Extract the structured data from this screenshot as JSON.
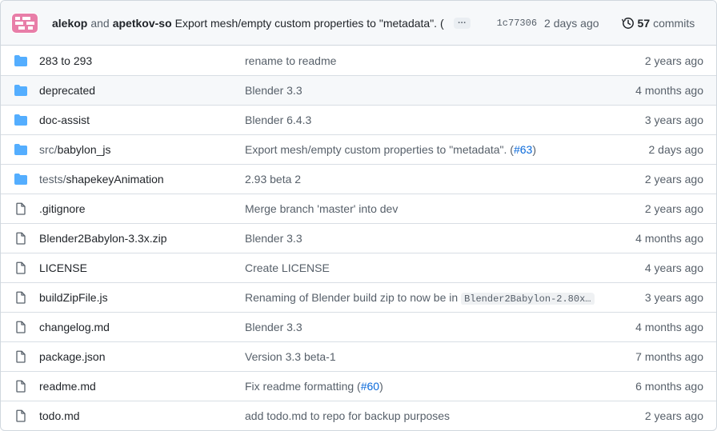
{
  "latest_commit": {
    "author1": "alekop",
    "and": "and",
    "author2": "apetkov-so",
    "message": "Export mesh/empty custom properties to \"metadata\". (",
    "ellipsis": "…",
    "sha": "1c77306",
    "date": "2 days ago",
    "commit_count": "57",
    "commits_label": "commits",
    "icon": "history-icon"
  },
  "files": [
    {
      "type": "folder",
      "name": "283 to 293",
      "message": "rename to readme",
      "age": "2 years ago"
    },
    {
      "type": "folder",
      "name": "deprecated",
      "message": "Blender 3.3",
      "age": "4 months ago"
    },
    {
      "type": "folder",
      "name": "doc-assist",
      "message": "Blender 6.4.3",
      "age": "3 years ago"
    },
    {
      "type": "folder",
      "name_prefix": "src/",
      "name": "babylon_js",
      "message": "Export mesh/empty custom properties to \"metadata\". (",
      "message_link": "#63",
      "message_suffix": ")",
      "age": "2 days ago"
    },
    {
      "type": "folder",
      "name_prefix": "tests/",
      "name": "shapekeyAnimation",
      "message": "2.93 beta 2",
      "age": "2 years ago"
    },
    {
      "type": "file",
      "name": ".gitignore",
      "message": "Merge branch 'master' into dev",
      "age": "2 years ago"
    },
    {
      "type": "file",
      "name": "Blender2Babylon-3.3x.zip",
      "message": "Blender 3.3",
      "age": "4 months ago"
    },
    {
      "type": "file",
      "name": "LICENSE",
      "message": "Create LICENSE",
      "age": "4 years ago"
    },
    {
      "type": "file",
      "name": "buildZipFile.js",
      "message": "Renaming of Blender build zip to now be in ",
      "message_code": "Blender2Babylon-2.80x…",
      "age": "3 years ago"
    },
    {
      "type": "file",
      "name": "changelog.md",
      "message": "Blender 3.3",
      "age": "4 months ago"
    },
    {
      "type": "file",
      "name": "package.json",
      "message": "Version 3.3 beta-1",
      "age": "7 months ago"
    },
    {
      "type": "file",
      "name": "readme.md",
      "message": "Fix readme formatting (",
      "message_link": "#60",
      "message_suffix": ")",
      "age": "6 months ago"
    },
    {
      "type": "file",
      "name": "todo.md",
      "message": "add todo.md to repo for backup purposes",
      "age": "2 years ago"
    }
  ],
  "colors": {
    "folder": "#54aeff",
    "link": "#0969da",
    "muted": "#57606a",
    "avatar": "#e87ea8"
  }
}
